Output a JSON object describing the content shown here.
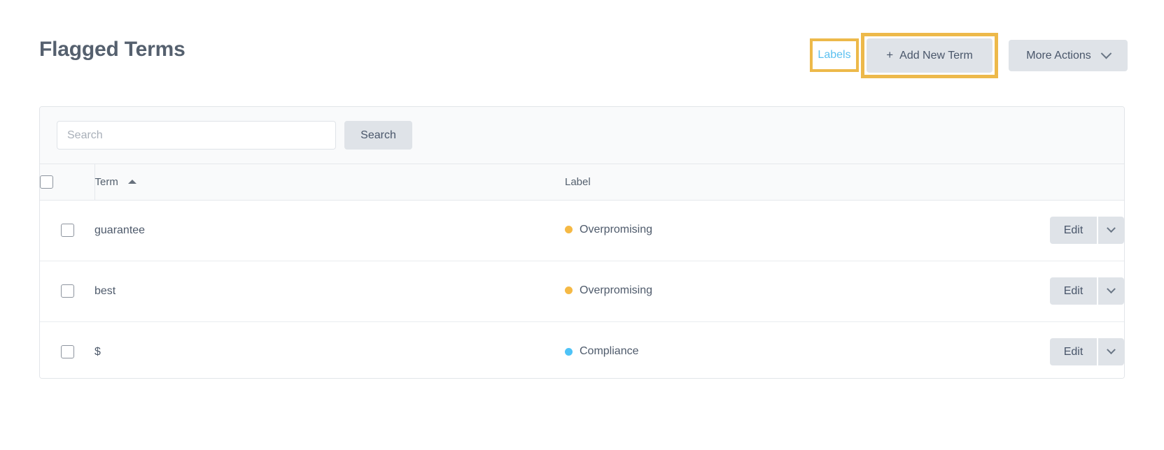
{
  "header": {
    "title": "Flagged Terms",
    "labels_link": "Labels",
    "add_new_term": "Add New Term",
    "add_new_term_plus": "+",
    "more_actions": "More Actions",
    "highlight_color": "#edb94a",
    "link_color": "#5bc0f0"
  },
  "toolbar": {
    "search_placeholder": "Search",
    "search_value": "",
    "search_button": "Search"
  },
  "table": {
    "columns": {
      "term": "Term",
      "label": "Label"
    },
    "sort": {
      "column": "Term",
      "direction": "asc"
    },
    "rows": [
      {
        "term": "guarantee",
        "label": "Overpromising",
        "label_color": "#f5b945",
        "edit": "Edit"
      },
      {
        "term": "best",
        "label": "Overpromising",
        "label_color": "#f5b945",
        "edit": "Edit"
      },
      {
        "term": "$",
        "label": "Compliance",
        "label_color": "#4ec3f7",
        "edit": "Edit"
      }
    ]
  }
}
